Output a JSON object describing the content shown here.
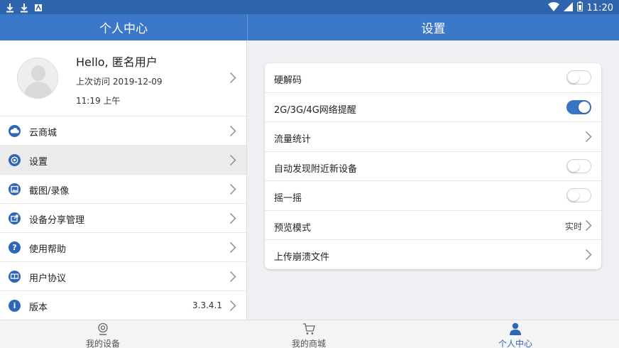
{
  "status_bar": {
    "time": "11:20"
  },
  "left_header": {
    "title": "个人中心"
  },
  "right_header": {
    "title": "设置"
  },
  "profile": {
    "greeting": "Hello, 匿名用户",
    "last_visit": "上次访问 2019-12-09",
    "last_visit_time": "11:19 上午"
  },
  "menu": {
    "items": [
      {
        "label": "云商城",
        "icon": "cloud-icon"
      },
      {
        "label": "设置",
        "icon": "settings-icon"
      },
      {
        "label": "截图/录像",
        "icon": "image-icon"
      },
      {
        "label": "设备分享管理",
        "icon": "share-icon"
      },
      {
        "label": "使用帮助",
        "icon": "help-icon"
      },
      {
        "label": "用户协议",
        "icon": "book-icon"
      },
      {
        "label": "版本",
        "icon": "info-icon",
        "value": "3.3.4.1"
      }
    ]
  },
  "settings": {
    "rows": [
      {
        "label": "硬解码",
        "type": "toggle",
        "on": false
      },
      {
        "label": "2G/3G/4G网络提醒",
        "type": "toggle",
        "on": true
      },
      {
        "label": "流量统计",
        "type": "link"
      },
      {
        "label": "自动发现附近新设备",
        "type": "toggle",
        "on": false
      },
      {
        "label": "摇一摇",
        "type": "toggle",
        "on": false
      },
      {
        "label": "预览模式",
        "type": "link",
        "value": "实时"
      },
      {
        "label": "上传崩溃文件",
        "type": "link"
      }
    ]
  },
  "bottom_nav": {
    "tabs": [
      {
        "label": "我的设备",
        "icon": "camera-icon"
      },
      {
        "label": "我的商城",
        "icon": "cart-icon"
      },
      {
        "label": "个人中心",
        "icon": "person-icon"
      }
    ]
  },
  "colors": {
    "primary": "#3c78c8",
    "status_bar": "#2f65ad",
    "accent": "#2f67b8",
    "background": "#f0eff4"
  }
}
